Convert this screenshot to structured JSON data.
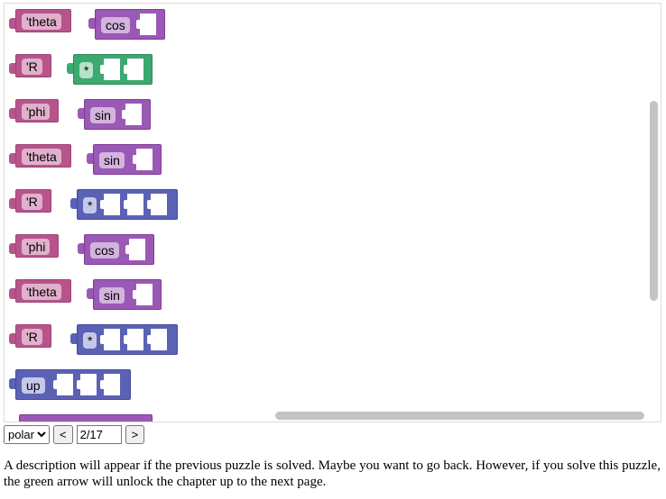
{
  "workspace": {
    "blocks": [
      {
        "kind": "var",
        "label": "'theta"
      },
      {
        "kind": "func",
        "label": "cos"
      },
      {
        "kind": "var",
        "label": "'R"
      },
      {
        "kind": "green",
        "label": "*"
      },
      {
        "kind": "var",
        "label": "'phi"
      },
      {
        "kind": "func",
        "label": "sin"
      },
      {
        "kind": "var",
        "label": "'theta"
      },
      {
        "kind": "func",
        "label": "sin"
      },
      {
        "kind": "var",
        "label": "'R"
      },
      {
        "kind": "mul",
        "label": "*"
      },
      {
        "kind": "var",
        "label": "'phi"
      },
      {
        "kind": "func",
        "label": "cos"
      },
      {
        "kind": "var",
        "label": "'theta"
      },
      {
        "kind": "func",
        "label": "sin"
      },
      {
        "kind": "var",
        "label": "'R"
      },
      {
        "kind": "mul",
        "label": "*"
      },
      {
        "kind": "mul",
        "label": "up"
      }
    ]
  },
  "controls": {
    "select_value": "polar",
    "prev_label": "<",
    "page_value": "2/17",
    "next_label": ">"
  },
  "description": "A description will appear if the previous puzzle is solved. Maybe you want to go back. However, if you solve this puzzle, the green arrow will unlock the chapter up to the next page.",
  "colors": {
    "variable": "#b8548c",
    "function": "#9b59b6",
    "multiply": "#5b62b5",
    "green": "#3ba970"
  }
}
